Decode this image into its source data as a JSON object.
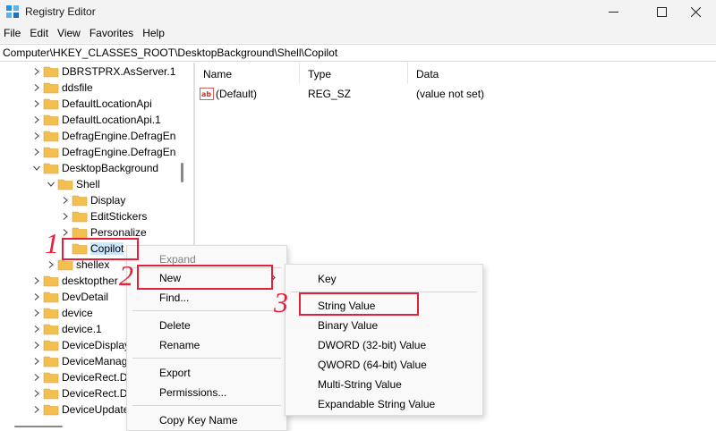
{
  "window": {
    "title": "Registry Editor",
    "icon": "registry-icon"
  },
  "menu": [
    "File",
    "Edit",
    "View",
    "Favorites",
    "Help"
  ],
  "address": "Computer\\HKEY_CLASSES_ROOT\\DesktopBackground\\Shell\\Copilot",
  "tree": {
    "items": [
      {
        "label": "DBRSTPRX.AsServer.1",
        "expanded": false,
        "selected": false
      },
      {
        "label": "ddsfile",
        "expanded": false,
        "selected": false
      },
      {
        "label": "DefaultLocationApi",
        "expanded": false,
        "selected": false
      },
      {
        "label": "DefaultLocationApi.1",
        "expanded": false,
        "selected": false
      },
      {
        "label": "DefragEngine.DefragEn",
        "expanded": false,
        "selected": false
      },
      {
        "label": "DefragEngine.DefragEn",
        "expanded": false,
        "selected": false
      },
      {
        "label": "DesktopBackground",
        "expanded": true,
        "selected": false
      },
      {
        "label": "Shell",
        "expanded": true,
        "selected": false
      },
      {
        "label": "Display",
        "expanded": false,
        "selected": false
      },
      {
        "label": "EditStickers",
        "expanded": false,
        "selected": false
      },
      {
        "label": "Personalize",
        "expanded": false,
        "selected": false
      },
      {
        "label": "Copilot",
        "expanded": false,
        "selected": true
      },
      {
        "label": "shellex",
        "expanded": false,
        "selected": false
      },
      {
        "label": "desktopther",
        "expanded": false,
        "selected": false
      },
      {
        "label": "DevDetail",
        "expanded": false,
        "selected": false
      },
      {
        "label": "device",
        "expanded": false,
        "selected": false
      },
      {
        "label": "device.1",
        "expanded": false,
        "selected": false
      },
      {
        "label": "DeviceDisplay",
        "expanded": false,
        "selected": false
      },
      {
        "label": "DeviceManag",
        "expanded": false,
        "selected": false
      },
      {
        "label": "DeviceRect.D",
        "expanded": false,
        "selected": false
      },
      {
        "label": "DeviceRect.D",
        "expanded": false,
        "selected": false
      },
      {
        "label": "DeviceUpdate",
        "expanded": false,
        "selected": false
      }
    ]
  },
  "list": {
    "columns": [
      "Name",
      "Type",
      "Data"
    ],
    "rows": [
      {
        "name": "(Default)",
        "type": "REG_SZ",
        "data": "(value not set)"
      }
    ]
  },
  "context_menu": {
    "items": [
      "Expand",
      "New",
      "Find...",
      "Delete",
      "Rename",
      "Export",
      "Permissions...",
      "Copy Key Name"
    ]
  },
  "submenu": {
    "items": [
      "Key",
      "String Value",
      "Binary Value",
      "DWORD (32-bit) Value",
      "QWORD (64-bit) Value",
      "Multi-String Value",
      "Expandable String Value"
    ]
  },
  "annotations": {
    "steps": [
      "1",
      "2",
      "3"
    ],
    "color": "#e3223a"
  },
  "colors": {
    "folder": "#f3c04f",
    "selection": "#cce8ff",
    "chrome": "#f3f3f3"
  }
}
